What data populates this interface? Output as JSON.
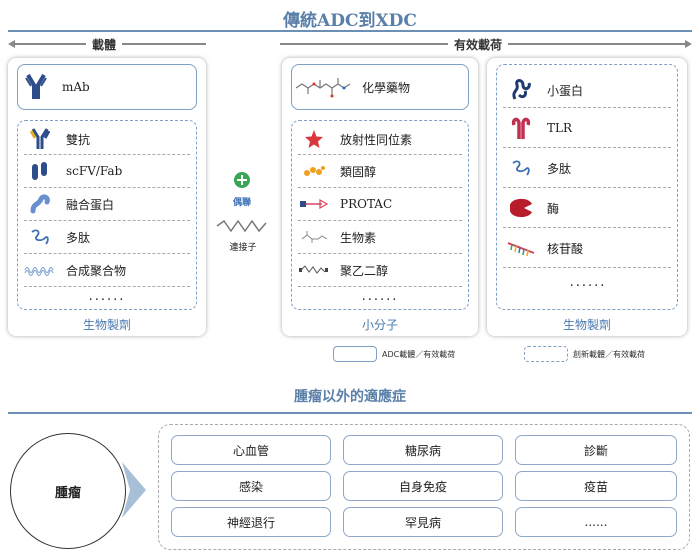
{
  "title": "傳統ADC到XDC",
  "carrier": {
    "header": "載體",
    "top": "mAb",
    "items": [
      "雙抗",
      "scFV/Fab",
      "融合蛋白",
      "多肽",
      "合成聚合物"
    ],
    "dots": "......",
    "footer": "生物製劑"
  },
  "linker": {
    "conjugate": "偶聯",
    "label": "連接子"
  },
  "payload": {
    "header": "有效載荷",
    "small": {
      "top": "化學藥物",
      "items": [
        "放射性同位素",
        "類固醇",
        "PROTAC",
        "生物素",
        "聚乙二醇"
      ],
      "dots": "......",
      "footer": "小分子"
    },
    "bio": {
      "items": [
        "小蛋白",
        "TLR",
        "多肽",
        "酶",
        "核苷酸"
      ],
      "dots": "......",
      "footer": "生物製劑"
    }
  },
  "legend": {
    "solid": "ADC載體／有效載荷",
    "dashed": "創新載體／有效載荷"
  },
  "indications": {
    "title": "腫瘤以外的適應症",
    "center": "腫瘤",
    "items": [
      "心血管",
      "糖尿病",
      "診斷",
      "感染",
      "自身免疫",
      "疫苗",
      "神經退行",
      "罕見病",
      "......"
    ]
  },
  "colors": {
    "accent": "#5a7fa8",
    "green": "#3aa655"
  }
}
